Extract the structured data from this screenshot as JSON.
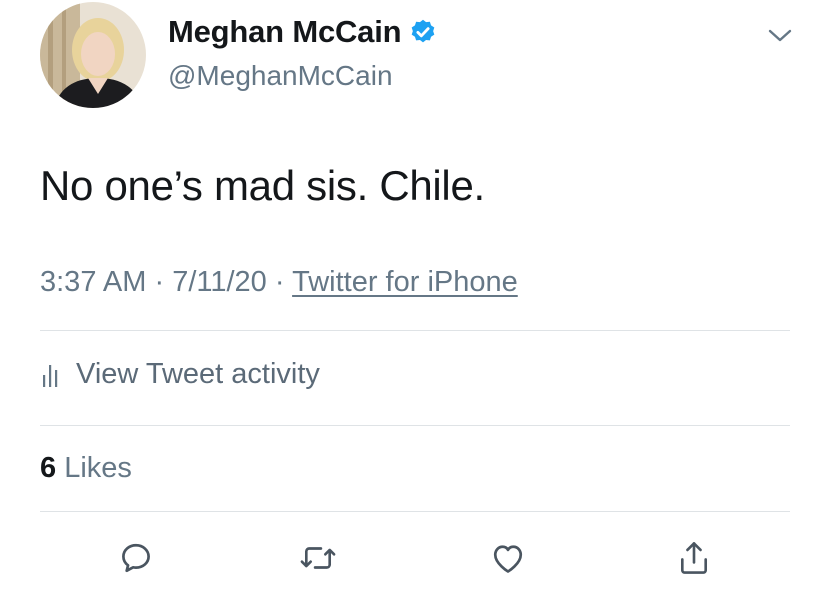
{
  "author": {
    "display_name": "Meghan McCain",
    "handle": "@MeghanMcCain",
    "verified": true
  },
  "tweet": {
    "text": "No one’s mad sis. Chile.",
    "time": "3:37 AM",
    "date": "7/11/20",
    "separator": "·",
    "source": "Twitter for iPhone"
  },
  "activity": {
    "label": "View Tweet activity"
  },
  "likes": {
    "count": "6",
    "label": "Likes"
  },
  "actions": [
    "reply-icon",
    "retweet-icon",
    "like-icon",
    "share-icon"
  ],
  "colors": {
    "text": "#14171a",
    "secondary": "#657786",
    "verified": "#1da1f2",
    "divider": "#dfe3e6"
  }
}
